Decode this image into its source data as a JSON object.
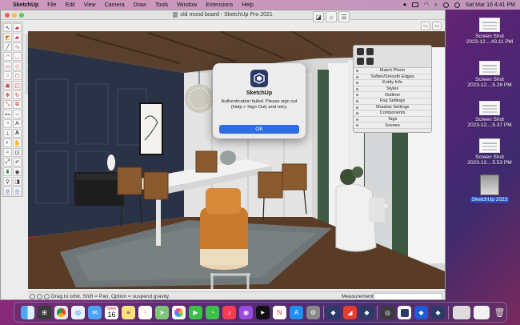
{
  "menubar": {
    "app": "SketchUp",
    "items": [
      "File",
      "Edit",
      "View",
      "Camera",
      "Draw",
      "Tools",
      "Window",
      "Extensions",
      "Help"
    ],
    "clock": "Sat Mar 16  4:41 PM"
  },
  "window": {
    "title": "old mood board - SketchUp Pro 2021"
  },
  "trays": {
    "items": [
      "Match Photo",
      "Soften/Smooth Edges",
      "Entity Info",
      "Styles",
      "Outliner",
      "Fog Settings",
      "Shadow Settings",
      "Components",
      "Tags",
      "Scenes"
    ]
  },
  "dialog": {
    "title": "SketchUp",
    "message_line1": "Authentication failed. Please sign out",
    "message_line2": "(Help > Sign Out) and retry.",
    "ok_label": "OK"
  },
  "status": {
    "hint": "Drag to orbit. Shift = Pan, Option = suspend gravity.",
    "measurements_label": "Measurements"
  },
  "desktop": {
    "files": [
      {
        "line1": "Screen Shot",
        "line2": "2023-12....43.11 PM"
      },
      {
        "line1": "Screen Shot",
        "line2": "2023-12....5.26 PM"
      },
      {
        "line1": "Screen Shot",
        "line2": "2023-12....5.37 PM"
      },
      {
        "line1": "Screen Shot",
        "line2": "2023-12....5.53 PM"
      }
    ],
    "disk_image": "SketchUp 2023"
  },
  "dock": {
    "calendar_month": "MAR",
    "calendar_day": "16",
    "icons": [
      "finder",
      "launchpad",
      "chrome",
      "safari",
      "mail",
      "calendar",
      "notes",
      "reminders",
      "maps",
      "photos",
      "facetime",
      "messages",
      "music",
      "podcasts",
      "tv",
      "news",
      "appstore",
      "settings",
      "sketchup",
      "sketchup-2023",
      "sketchup-layout",
      "downloads",
      "trash"
    ]
  }
}
